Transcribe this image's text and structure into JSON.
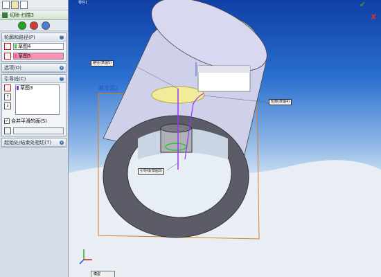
{
  "panel": {
    "feature_title": "切除-扫描3",
    "profile_path_header": "轮廓和路径(P)",
    "profile_field": "草图4",
    "path_field": "草图5",
    "options_header": "选项(O)",
    "guides_header": "引导线(C)",
    "guides_list": [
      "草图3"
    ],
    "merge_faces_label": "合并平滑的面(S)",
    "start_end_header": "起始处/结束处相切(T)"
  },
  "viewport": {
    "part_name": "零件1",
    "callouts": {
      "path_top": "路径(草图5)",
      "profile_right": "轮廓(草图4)",
      "guide_center": "引导线(草图3)"
    },
    "plane_label": "基准面2",
    "bottom_tab": "模型"
  },
  "colors": {
    "profile_swatch": "#3cc83c",
    "path_swatch": "#ff7aa8",
    "guide_swatch": "#8a2be2",
    "plane_orange": "#e07a20"
  },
  "icons": [
    "feature-icon",
    "confirm-icon",
    "cancel-icon",
    "detail-icon",
    "profile-icon",
    "path-icon",
    "guide-icon",
    "up-arrow-icon",
    "down-arrow-icon",
    "chevron-icon",
    "triad-icon"
  ]
}
